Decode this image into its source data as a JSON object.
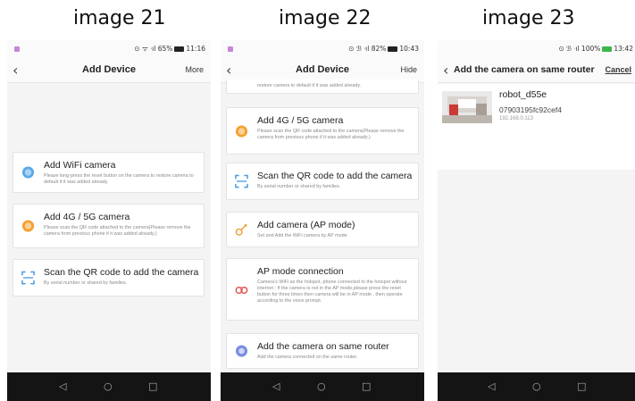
{
  "captions": [
    "image 21",
    "image 22",
    "image 23"
  ],
  "screen21": {
    "status": "⊙ ᯤ ᐧıl 65%",
    "time": "11:16",
    "back": "‹",
    "title": "Add Device",
    "right": "More",
    "cards": [
      {
        "title": "Add WiFi camera",
        "desc": "Please long-press the reset button on the camera to restore camera to default if it was added already."
      },
      {
        "title": "Add 4G / 5G camera",
        "desc": "Please scan the QR code attached to the camera(Please remove the camera from previous phone if it was added already.)"
      },
      {
        "title": "Scan the QR code to add the camera",
        "desc": "By serial number or shared by families."
      }
    ]
  },
  "screen22": {
    "status": "⊙ ℬ ᐧıl 82%",
    "time": "10:43",
    "back": "‹",
    "title": "Add Device",
    "right": "Hide",
    "top_partial": "restore camera to default if it was added already.",
    "cards": [
      {
        "title": "Add 4G / 5G camera",
        "desc": "Please scan the QR code attached to the camera(Please remove the camera from previous phone if it was added already.)"
      },
      {
        "title": "Scan the QR code to add the camera",
        "desc": "By serial number or shared by families."
      },
      {
        "title": "Add camera (AP mode)",
        "desc": "Set and Add the WiFi camera by AP mode"
      },
      {
        "title": "AP mode connection",
        "desc": "Camera's WiFi as the hotspot, phone connected to the hotspot without internet ; If the camera is not in the AP mode,please press the reset button for three times then camera will be in AP mode , then operate according to the voice prompt."
      },
      {
        "title": "Add the camera on same router",
        "desc": "Add the camera connected on the same router."
      }
    ]
  },
  "screen23": {
    "status": "⊙ ℬ ᐧıl 100%",
    "time": "13:42",
    "back": "‹",
    "title": "Add the camera on same router",
    "right": "Cancel",
    "device": {
      "name": "robot_d55e",
      "id": "07903195fc92cef4",
      "ip": "192.168.0.113"
    }
  },
  "nav_buttons": {
    "back": "◁",
    "home": "○",
    "recent": "□"
  },
  "colors": {
    "accent_orange": "#f5a030",
    "accent_blue": "#4a9be0",
    "divider": "#e3e3e3"
  }
}
